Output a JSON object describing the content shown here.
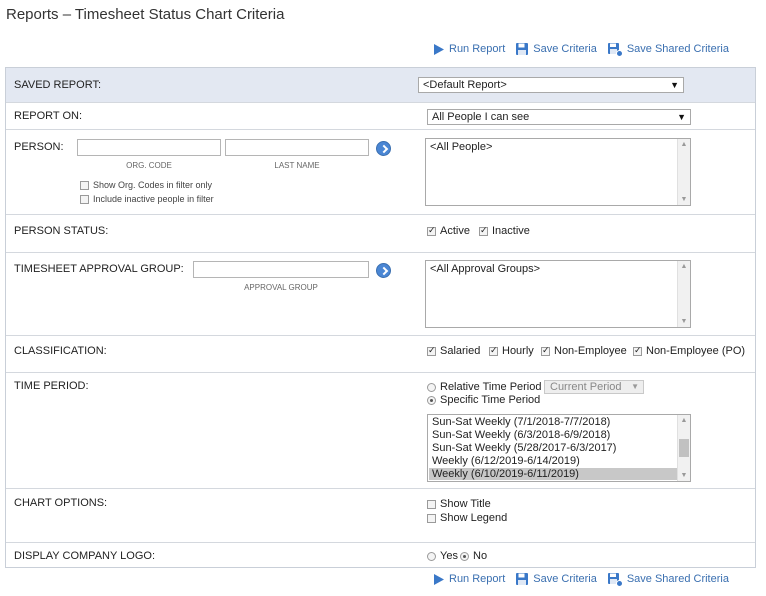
{
  "page": {
    "title": "Reports – Timesheet Status Chart Criteria"
  },
  "actions": {
    "run_report": "Run Report",
    "save_criteria": "Save Criteria",
    "save_shared_criteria": "Save Shared Criteria"
  },
  "saved_report": {
    "label": "SAVED REPORT:",
    "value": "<Default Report>"
  },
  "report_on": {
    "label": "REPORT ON:",
    "value": "All People I can see"
  },
  "person": {
    "label": "PERSON:",
    "org_code_caption": "ORG. CODE",
    "last_name_caption": "LAST NAME",
    "org_code_value": "",
    "last_name_value": "",
    "show_org_codes": "Show Org. Codes in filter only",
    "include_inactive": "Include inactive people in filter",
    "list": [
      "<All People>"
    ]
  },
  "person_status": {
    "label": "PERSON STATUS:",
    "active": "Active",
    "inactive": "Inactive"
  },
  "approval_group": {
    "label": "TIMESHEET APPROVAL GROUP:",
    "caption": "APPROVAL GROUP",
    "value": "",
    "list": [
      "<All Approval Groups>"
    ]
  },
  "classification": {
    "label": "CLASSIFICATION:",
    "salaried": "Salaried",
    "hourly": "Hourly",
    "non_employee": "Non-Employee",
    "non_employee_po": "Non-Employee (PO)"
  },
  "time_period": {
    "label": "TIME PERIOD:",
    "relative": "Relative Time Period",
    "relative_value": "Current Period",
    "specific": "Specific Time Period",
    "periods": [
      "Sun-Sat Weekly (7/1/2018-7/7/2018)",
      "Sun-Sat Weekly (6/3/2018-6/9/2018)",
      "Sun-Sat Weekly (5/28/2017-6/3/2017)",
      "Weekly (6/12/2019-6/14/2019)",
      "Weekly (6/10/2019-6/11/2019)"
    ]
  },
  "chart_options": {
    "label": "CHART OPTIONS:",
    "show_title": "Show Title",
    "show_legend": "Show Legend"
  },
  "company_logo": {
    "label": "DISPLAY COMPANY LOGO:",
    "yes": "Yes",
    "no": "No"
  },
  "colors": {
    "accent": "#3a6fb0",
    "header_bg": "#e3e8f2",
    "go_button": "#4a86d4"
  },
  "icons": {
    "run": "play-icon",
    "save": "floppy-disk-icon",
    "save_shared": "shared-floppy-icon",
    "go": "chevron-right-icon"
  }
}
